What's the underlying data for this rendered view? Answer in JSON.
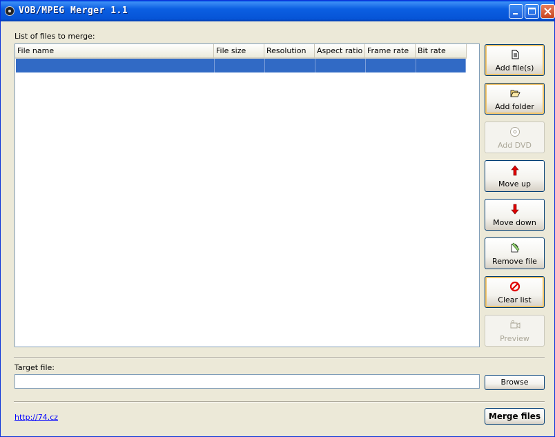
{
  "window": {
    "title": "VOB/MPEG Merger 1.1"
  },
  "list": {
    "label": "List of files to merge:",
    "columns": [
      "File name",
      "File size",
      "Resolution",
      "Aspect ratio",
      "Frame rate",
      "Bit rate"
    ],
    "selected_row_index": 0
  },
  "side_buttons": {
    "add_files": "Add file(s)",
    "add_folder": "Add folder",
    "add_dvd": "Add DVD",
    "move_up": "Move up",
    "move_down": "Move down",
    "remove_file": "Remove file",
    "clear_list": "Clear list",
    "preview": "Preview"
  },
  "target": {
    "label": "Target file:",
    "value": "",
    "browse": "Browse"
  },
  "footer": {
    "link": "http://74.cz",
    "merge": "Merge files"
  },
  "colors": {
    "titlebar": "#0654d6",
    "selection": "#316ac5",
    "face": "#ece9d8"
  }
}
